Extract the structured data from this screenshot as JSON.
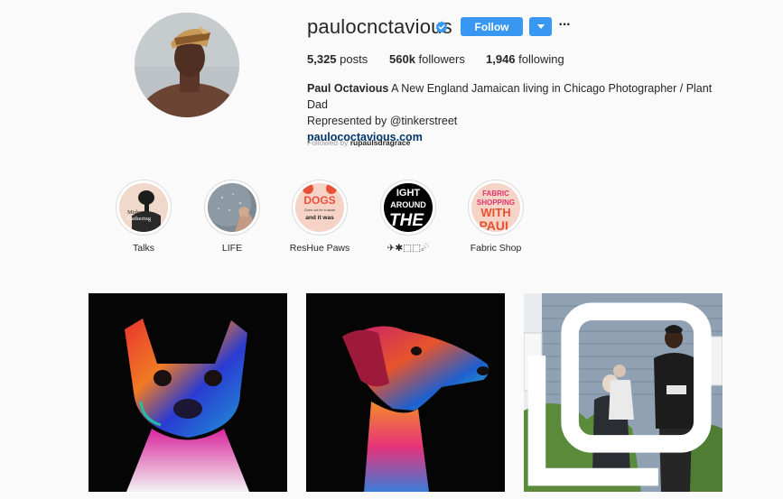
{
  "profile": {
    "username": "paulocnctavious",
    "full_name": "Paul Octavious",
    "bio_line1": "A New England Jamaican living in Chicago Photographer / Plant Dad",
    "bio_line2_prefix": "Represented by ",
    "bio_mention": "@tinkerstreet",
    "website": "paulococtavious.com",
    "followed_by_prefix": "Followed by ",
    "followed_by_user": "rupaulsdragrace"
  },
  "actions": {
    "follow_label": "Follow",
    "dropdown_icon": "caret-down-icon",
    "more_label": "···"
  },
  "stats": {
    "posts_count": "5,325",
    "posts_label": " posts",
    "followers_count": "560k",
    "followers_label": " followers",
    "following_count": "1,946",
    "following_label": " following"
  },
  "highlights": [
    {
      "label": "Talks"
    },
    {
      "label": "LIFE"
    },
    {
      "label": "ResHue Paws"
    },
    {
      "label": "✈✱⬚⬚☄"
    },
    {
      "label": "Fabric Shop"
    }
  ],
  "highlight_art": {
    "talks_line1": "Midwest",
    "talks_line2": "Gathering",
    "reshue_line1": "DOGS",
    "reshue_line2": "Come out for a cause",
    "reshue_line3": "and it was",
    "flight_line1": "IGHT",
    "flight_line2": "AROUND",
    "flight_line3": "THE",
    "fabric_line1": "FABRIC",
    "fabric_line2": "SHOPPING",
    "fabric_line3": "WITH",
    "fabric_line4": "PAUL"
  },
  "colors": {
    "accent": "#3897f0",
    "text": "#262626",
    "muted": "#999999",
    "link": "#003569",
    "background": "#fafafa"
  }
}
